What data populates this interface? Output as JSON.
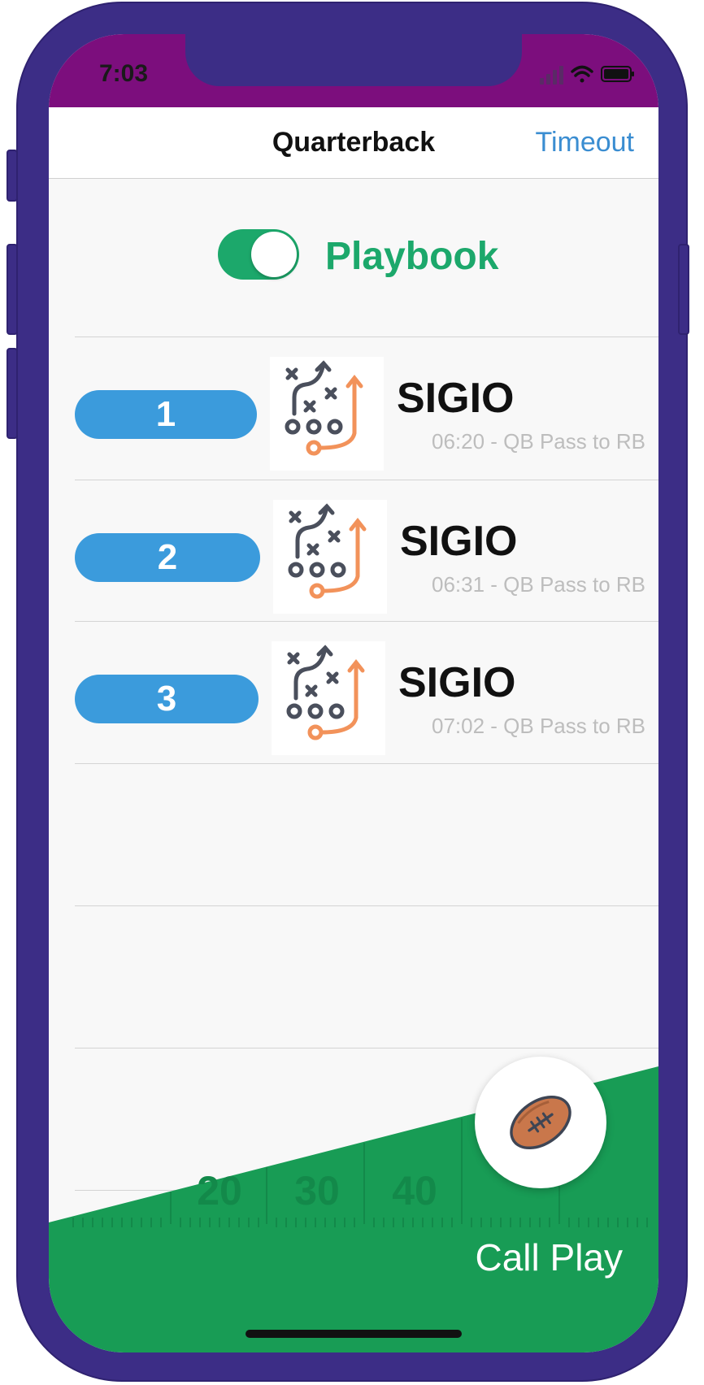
{
  "status_bar": {
    "time": "7:03"
  },
  "nav": {
    "title": "Quarterback",
    "action": "Timeout"
  },
  "playbook": {
    "label": "Playbook",
    "enabled": true
  },
  "plays": [
    {
      "number": "1",
      "name": "SIGIO",
      "detail": "06:20 - QB Pass to RB"
    },
    {
      "number": "2",
      "name": "SIGIO",
      "detail": "06:31 - QB Pass to RB"
    },
    {
      "number": "3",
      "name": "SIGIO",
      "detail": "07:02 - QB Pass to RB"
    }
  ],
  "field": {
    "yard_numbers": [
      "20",
      "30",
      "40"
    ]
  },
  "call_play": {
    "label": "Call Play",
    "icon": "football-icon"
  },
  "colors": {
    "frame": "#3c2d86",
    "status_bar": "#7c0e7d",
    "accent_green": "#1ca86b",
    "field_green": "#189c55",
    "pill_blue": "#3b9bdc",
    "link_blue": "#3a8dd1",
    "play_diagram_dark": "#4a4f5c",
    "play_diagram_orange": "#f2925a"
  }
}
